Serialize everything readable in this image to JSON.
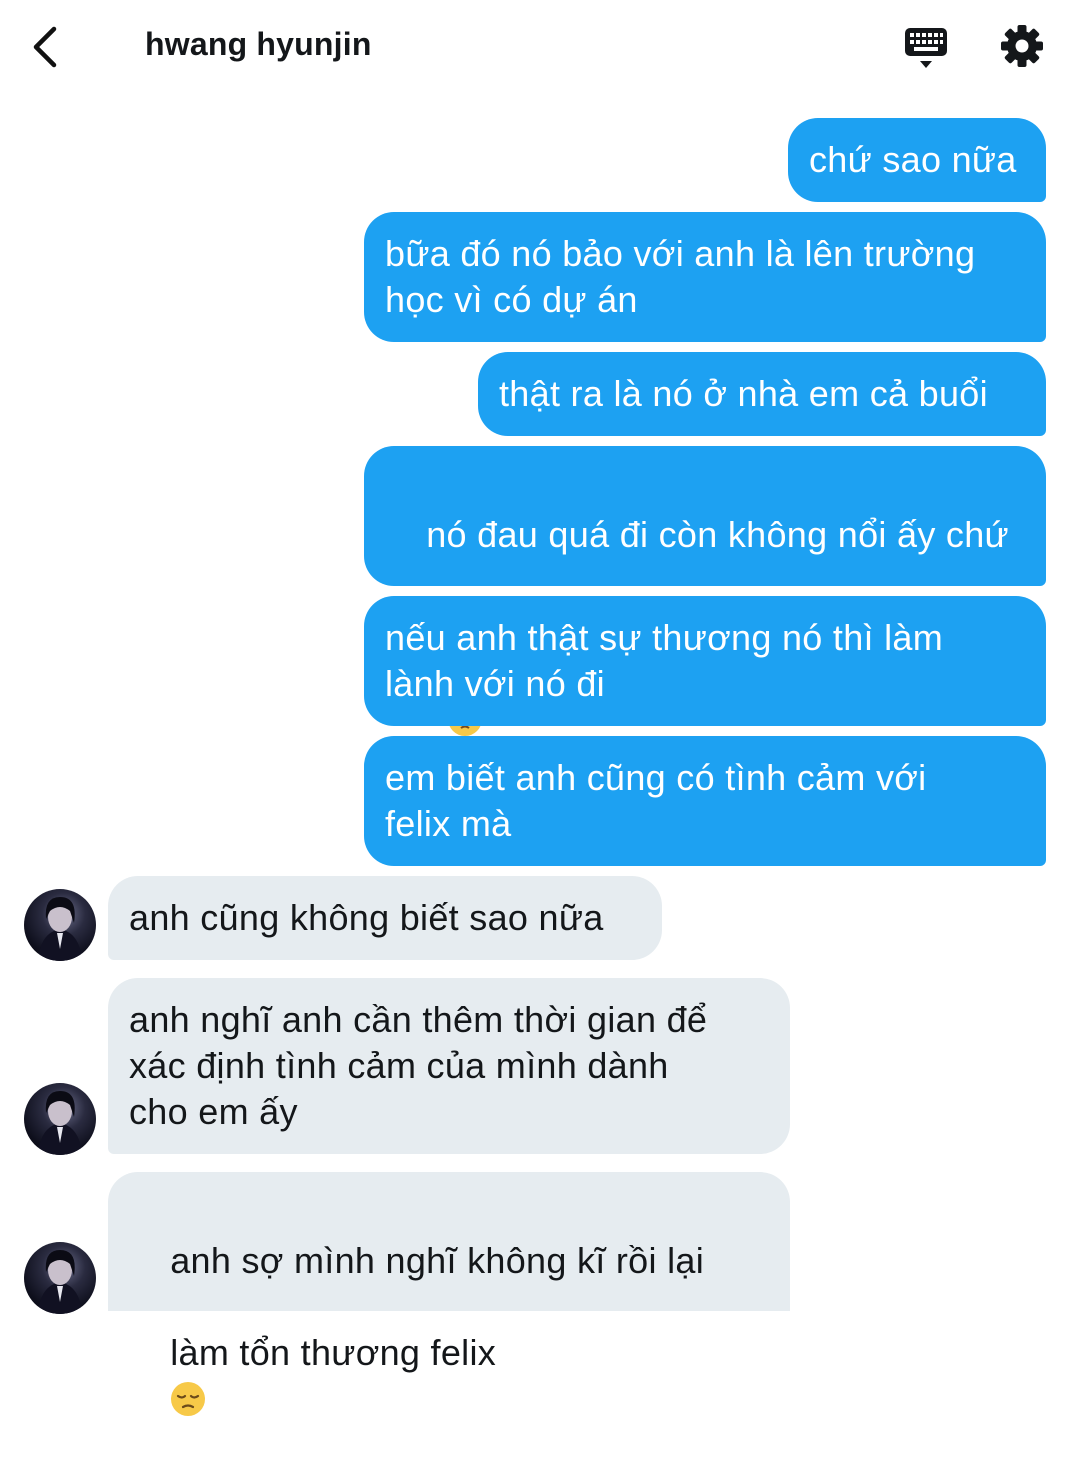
{
  "header": {
    "title": "hwang hyunjin",
    "back_icon": "chevron-left-icon",
    "keyboard_icon": "keyboard-icon",
    "settings_icon": "gear-icon"
  },
  "colors": {
    "sent_bubble": "#1da1f2",
    "received_bubble": "#e6ecf0"
  },
  "messages": {
    "m1": "chứ sao nữa",
    "m2": "bữa đó nó bảo với anh là lên trường\nhọc vì có dự án",
    "m3": "thật ra là nó ở nhà em cả buổi",
    "m4": "nó đau quá đi còn không nổi ấy chứ",
    "m5": "nếu anh thật sự thương nó thì làm\nlành với nó đi",
    "m6": "em biết anh cũng có tình cảm với\nfelix mà",
    "r1": "anh cũng không biết sao nữa",
    "r2": "anh nghĩ anh cần thêm thời gian để\nxác định tình cảm của mình dành\ncho em ấy",
    "r3a": "anh sợ mình nghĩ không kĩ rồi lại",
    "r3b": "làm tổn thương felix"
  }
}
